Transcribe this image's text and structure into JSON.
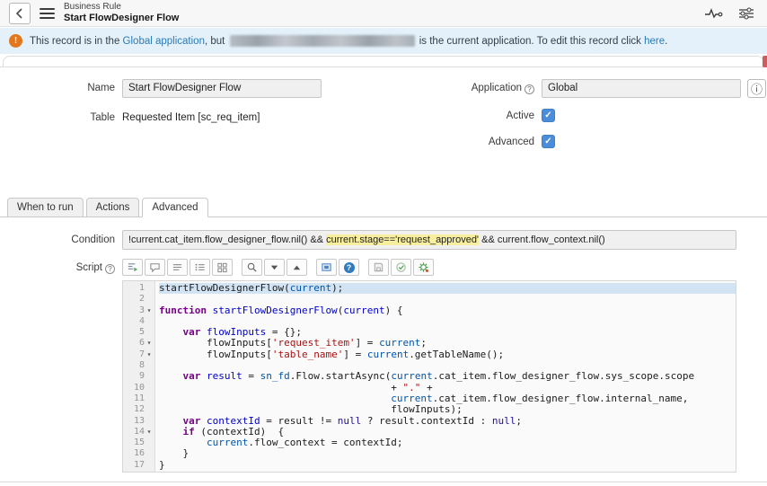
{
  "header": {
    "record_type": "Business Rule",
    "record_name": "Start FlowDesigner Flow"
  },
  "banner": {
    "text1": "This record is in the ",
    "link1": "Global application",
    "text2": ", but ",
    "text3": " is the current application. To edit this record click ",
    "link2": "here",
    "text4": "."
  },
  "icons": {
    "help_glyph": "?",
    "info_glyph": "ⓘ",
    "check_glyph": "✓",
    "fold_glyph": "▾"
  },
  "form": {
    "name_label": "Name",
    "name_value": "Start FlowDesigner Flow",
    "table_label": "Table",
    "table_value": "Requested Item [sc_req_item]",
    "application_label": "Application",
    "application_value": "Global",
    "active_label": "Active",
    "active_checked": true,
    "advanced_label": "Advanced",
    "advanced_checked": true
  },
  "tabs": {
    "items": [
      "When to run",
      "Actions",
      "Advanced"
    ],
    "active": "Advanced"
  },
  "condition": {
    "label": "Condition",
    "prefix": "!current.cat_item.flow_designer_flow.nil() && ",
    "highlight": "current.stage=='request_approved'",
    "suffix": " && current.flow_context.nil()"
  },
  "script": {
    "label": "Script",
    "toolbar_icons": [
      "format-code",
      "comment-code",
      "comment-lines",
      "line-numbers",
      "replace-grid",
      "search",
      "find-next",
      "find-previous",
      "full-screen",
      "help",
      "save",
      "syntax-check",
      "script-debugger"
    ]
  },
  "colors": {
    "checkbox_blue": "#4a8edb",
    "highlight_yellow": "#f7ef9e",
    "banner_bg": "#e4f1fa",
    "warning_orange": "#e2771d",
    "link_blue": "#2a7ab5",
    "selected_line_blue": "#d2e3f3"
  },
  "editor": {
    "lines": [
      {
        "n": 1,
        "sel": true,
        "t": [
          [
            "",
            "startFlowDesignerFlow("
          ],
          [
            "v",
            "current"
          ],
          [
            "",
            ");"
          ]
        ]
      },
      {
        "n": 2,
        "t": []
      },
      {
        "n": 3,
        "fold": true,
        "t": [
          [
            "k",
            "function"
          ],
          [
            "",
            " "
          ],
          [
            "d",
            "startFlowDesignerFlow"
          ],
          [
            "",
            "("
          ],
          [
            "d",
            "current"
          ],
          [
            "",
            ") {"
          ]
        ]
      },
      {
        "n": 4,
        "t": []
      },
      {
        "n": 5,
        "t": [
          [
            "",
            "    "
          ],
          [
            "k",
            "var"
          ],
          [
            "",
            " "
          ],
          [
            "d",
            "flowInputs"
          ],
          [
            "",
            " = {};"
          ]
        ]
      },
      {
        "n": 6,
        "fold": true,
        "t": [
          [
            "",
            "        flowInputs["
          ],
          [
            "s",
            "'request_item'"
          ],
          [
            "",
            "] = "
          ],
          [
            "v",
            "current"
          ],
          [
            "",
            ";"
          ]
        ]
      },
      {
        "n": 7,
        "fold": true,
        "t": [
          [
            "",
            "        flowInputs["
          ],
          [
            "s",
            "'table_name'"
          ],
          [
            "",
            "] = "
          ],
          [
            "v",
            "current"
          ],
          [
            "",
            ".getTableName();"
          ]
        ]
      },
      {
        "n": 8,
        "t": []
      },
      {
        "n": 9,
        "t": [
          [
            "",
            "    "
          ],
          [
            "k",
            "var"
          ],
          [
            "",
            " "
          ],
          [
            "d",
            "result"
          ],
          [
            "",
            " = "
          ],
          [
            "v",
            "sn_fd"
          ],
          [
            "",
            ".Flow.startAsync("
          ],
          [
            "v",
            "current"
          ],
          [
            "",
            ".cat_item.flow_designer_flow.sys_scope.scope"
          ]
        ]
      },
      {
        "n": 10,
        "t": [
          [
            "",
            "                                       + "
          ],
          [
            "s",
            "\".\""
          ],
          [
            "",
            " +"
          ]
        ]
      },
      {
        "n": 11,
        "t": [
          [
            "",
            "                                       "
          ],
          [
            "v",
            "current"
          ],
          [
            "",
            ".cat_item.flow_designer_flow.internal_name,"
          ]
        ]
      },
      {
        "n": 12,
        "t": [
          [
            "",
            "                                       flowInputs);"
          ]
        ]
      },
      {
        "n": 13,
        "t": [
          [
            "",
            "    "
          ],
          [
            "k",
            "var"
          ],
          [
            "",
            " "
          ],
          [
            "d",
            "contextId"
          ],
          [
            "",
            " = result != "
          ],
          [
            "a",
            "null"
          ],
          [
            "",
            " ? result.contextId : "
          ],
          [
            "a",
            "null"
          ],
          [
            "",
            ";"
          ]
        ]
      },
      {
        "n": 14,
        "fold": true,
        "t": [
          [
            "",
            "    "
          ],
          [
            "k",
            "if"
          ],
          [
            "",
            " (contextId)  {"
          ]
        ]
      },
      {
        "n": 15,
        "t": [
          [
            "",
            "        "
          ],
          [
            "v",
            "current"
          ],
          [
            "",
            ".flow_context = contextId;"
          ]
        ]
      },
      {
        "n": 16,
        "t": [
          [
            "",
            "    }"
          ]
        ]
      },
      {
        "n": 17,
        "t": [
          [
            "",
            "}"
          ]
        ]
      }
    ]
  }
}
